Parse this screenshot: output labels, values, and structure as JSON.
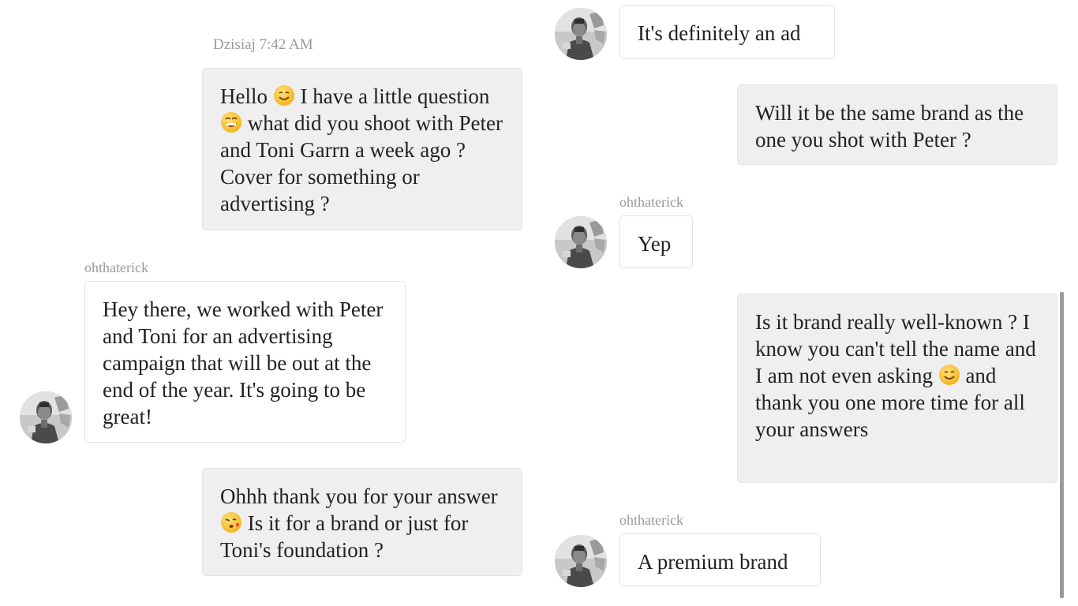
{
  "conversation": {
    "timestamp": "Dzisiaj 7:42 AM",
    "left_column": {
      "msg1": {
        "part1": "Hello ",
        "emoji1": "smiling-face-icon",
        "part2": " I have a little question ",
        "emoji2": "grinning-face-icon",
        "part3": " what did you shoot with Peter and Toni Garrn a week ago ? Cover for something or advertising ?"
      },
      "reply1_username": "ohthaterick",
      "reply1_text": "Hey there, we worked with Peter and Toni for an advertising campaign that will be out at the end of the year. It's going to be great!",
      "msg2": {
        "part1": "Ohhh thank you for your answer ",
        "emoji1": "kissing-face-icon",
        "part2": " Is it for a brand or just for Toni's foundation ?"
      }
    },
    "right_column": {
      "reply2_text": "It's definitely an ad",
      "msg3_text": "Will it be the same brand as the one you shot with Peter ?",
      "reply3_username": "ohthaterick",
      "reply3_text": "Yep",
      "msg4": {
        "part1": "Is it brand really well-known ? I know you can't tell the name and I am not even asking ",
        "emoji1": "smiling-face-icon",
        "part2": " and thank you one more time for all your answers"
      },
      "reply4_username": "ohthaterick",
      "reply4_text": "A premium brand"
    }
  },
  "colors": {
    "outgoing_bubble": "#efefef",
    "incoming_bubble": "#ffffff",
    "meta_text": "#999999",
    "emoji_yellow": "#f7c23a"
  }
}
